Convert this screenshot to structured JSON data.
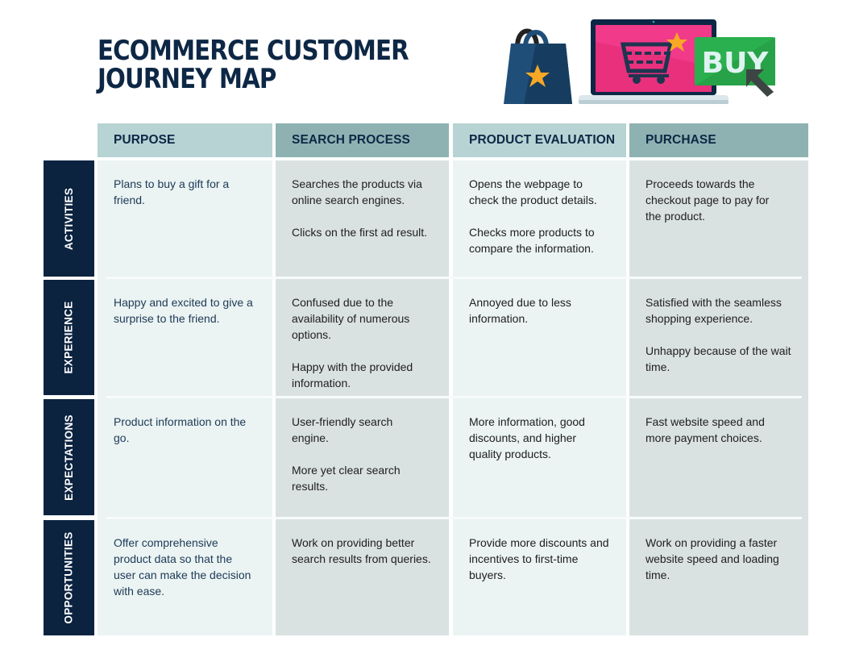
{
  "title": {
    "line1": "ECOMMERCE CUSTOMER",
    "line2": "JOURNEY MAP"
  },
  "illustration": {
    "bag_icon": "shopping-bag-icon",
    "laptop_icon": "laptop-cart-icon",
    "buy_label": "BUY",
    "cursor_icon": "cursor-arrow-icon",
    "colors": {
      "bag": "#1f4e79",
      "star": "#f9a825",
      "screen": "#e8307c",
      "buy_button": "#2bb04f",
      "navy": "#0d2745"
    }
  },
  "columns": [
    {
      "label": "PURPOSE"
    },
    {
      "label": "SEARCH PROCESS"
    },
    {
      "label": "PRODUCT EVALUATION"
    },
    {
      "label": "PURCHASE"
    }
  ],
  "rows": [
    {
      "label": "ACTIVITIES",
      "cells": [
        [
          "Plans to buy a gift for a friend."
        ],
        [
          "Searches the products via online search engines.",
          "Clicks on the first ad result."
        ],
        [
          "Opens the webpage to check the product details.",
          "Checks more products to compare the information."
        ],
        [
          "Proceeds towards the checkout page to pay for the product."
        ]
      ]
    },
    {
      "label": "EXPERIENCE",
      "cells": [
        [
          "Happy and excited to give a surprise to the friend."
        ],
        [
          "Confused due to the availability of numerous options.",
          "Happy with the provided information."
        ],
        [
          "Annoyed due to less information."
        ],
        [
          "Satisfied with the seamless shopping experience.",
          "Unhappy because of the wait time."
        ]
      ]
    },
    {
      "label": "EXPECTATIONS",
      "cells": [
        [
          "Product information on the go."
        ],
        [
          "User-friendly search engine.",
          "More yet clear search results."
        ],
        [
          "More information, good discounts, and higher quality products."
        ],
        [
          "Fast website speed and more payment choices."
        ]
      ]
    },
    {
      "label": "OPPORTUNITIES",
      "cells": [
        [
          "Offer comprehensive product data so that the user can make the decision with ease."
        ],
        [
          "Work on providing better search results from queries."
        ],
        [
          "Provide more discounts and incentives to first-time buyers."
        ],
        [
          "Work on providing a faster website speed and loading time."
        ]
      ]
    }
  ]
}
